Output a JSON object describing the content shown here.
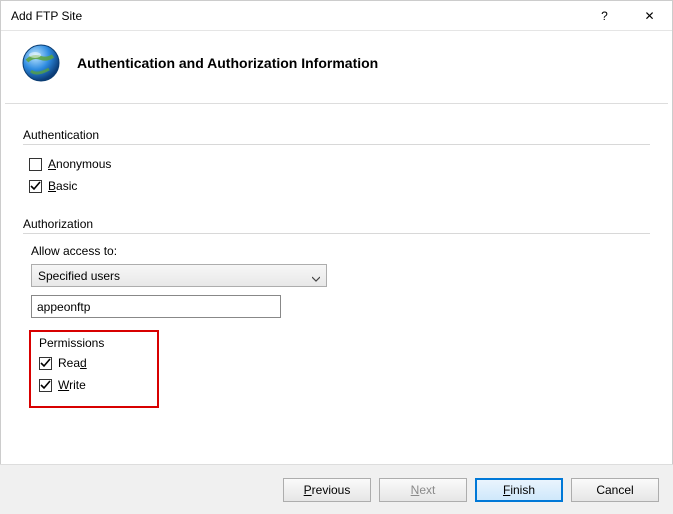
{
  "window": {
    "title": "Add FTP Site",
    "help_glyph": "?",
    "close_glyph": "✕"
  },
  "header": {
    "title": "Authentication and Authorization Information"
  },
  "authentication": {
    "legend": "Authentication",
    "anonymous": {
      "label_pre": "",
      "label_u": "A",
      "label_post": "nonymous",
      "checked": false
    },
    "basic": {
      "label_pre": "",
      "label_u": "B",
      "label_post": "asic",
      "checked": true
    }
  },
  "authorization": {
    "legend": "Authorization",
    "allow_label": "Allow access to:",
    "dropdown_value": "Specified users",
    "specified_users_value": "appeonftp"
  },
  "permissions": {
    "legend": "Permissions",
    "read": {
      "label_pre": "Rea",
      "label_u": "d",
      "label_post": "",
      "checked": true
    },
    "write": {
      "label_pre": "",
      "label_u": "W",
      "label_post": "rite",
      "checked": true
    }
  },
  "buttons": {
    "previous": {
      "pre": "",
      "u": "P",
      "post": "revious"
    },
    "next": {
      "pre": "",
      "u": "N",
      "post": "ext"
    },
    "finish": {
      "pre": "",
      "u": "F",
      "post": "inish"
    },
    "cancel": {
      "label": "Cancel"
    }
  }
}
